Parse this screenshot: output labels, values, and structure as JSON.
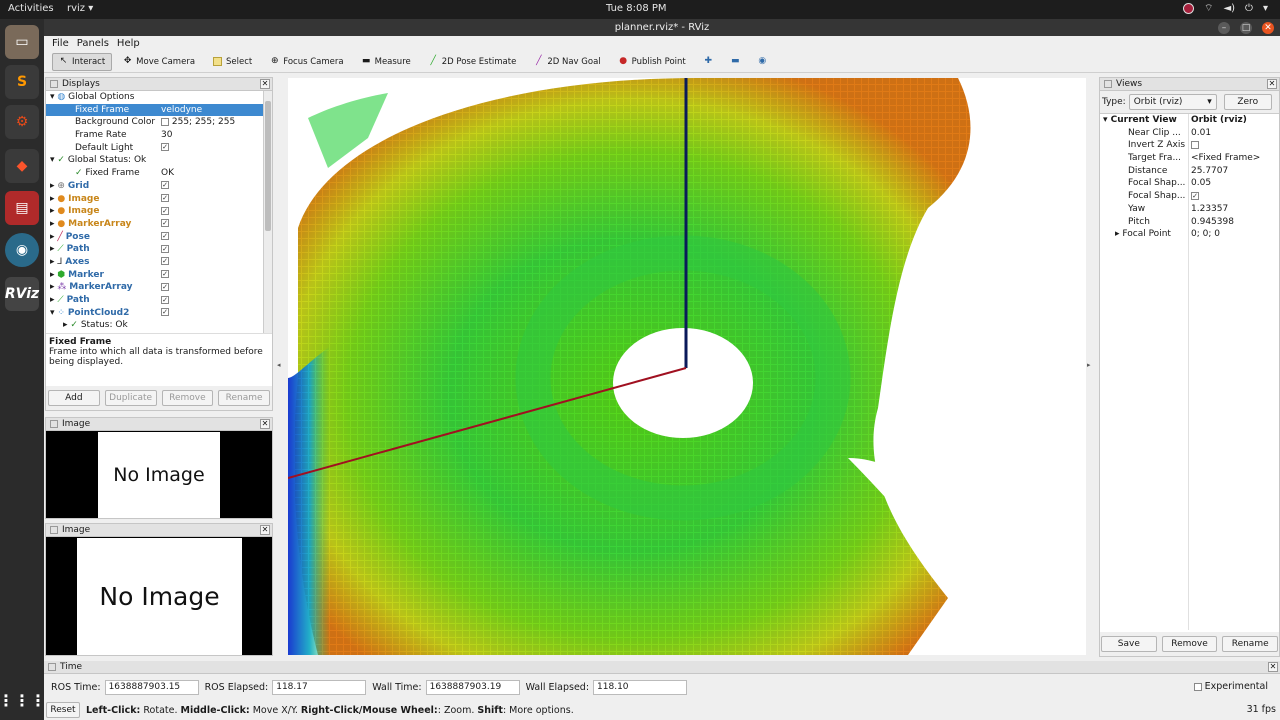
{
  "topbar": {
    "activities": "Activities",
    "app": "rviz",
    "clock": "Tue  8:08 PM"
  },
  "dock": {
    "rviz_label": "RViz"
  },
  "window": {
    "title": "planner.rviz* - RViz"
  },
  "menu": [
    "File",
    "Panels",
    "Help"
  ],
  "toolbar": [
    {
      "label": "Interact",
      "icon": "cursor-icon"
    },
    {
      "label": "Move Camera",
      "icon": "move-icon"
    },
    {
      "label": "Select",
      "icon": "select-icon"
    },
    {
      "label": "Focus Camera",
      "icon": "focus-icon"
    },
    {
      "label": "Measure",
      "icon": "ruler-icon"
    },
    {
      "label": "2D Pose Estimate",
      "icon": "arrow-green-icon"
    },
    {
      "label": "2D Nav Goal",
      "icon": "arrow-purple-icon"
    },
    {
      "label": "Publish Point",
      "icon": "pin-icon"
    }
  ],
  "displays": {
    "title": "Displays",
    "global_options": "Global Options",
    "fixed_frame_k": "Fixed Frame",
    "fixed_frame_v": "velodyne",
    "bg_k": "Background Color",
    "bg_v": "255; 255; 255",
    "fr_k": "Frame Rate",
    "fr_v": "30",
    "dl_k": "Default Light",
    "status_k": "Global Status: Ok",
    "status_ff_k": "Fixed Frame",
    "status_ff_v": "OK",
    "items": [
      "Grid",
      "Image",
      "Image",
      "MarkerArray",
      "Pose",
      "Path",
      "Axes",
      "Marker",
      "MarkerArray",
      "Path",
      "PointCloud2"
    ],
    "last_status": "Status: Ok",
    "desc_title": "Fixed Frame",
    "desc_body": "Frame into which all data is transformed before being displayed.",
    "buttons": {
      "add": "Add",
      "duplicate": "Duplicate",
      "remove": "Remove",
      "rename": "Rename"
    }
  },
  "image_panels": [
    {
      "title": "Image",
      "text": "No Image"
    },
    {
      "title": "Image",
      "text": "No Image"
    }
  ],
  "views": {
    "title": "Views",
    "type_label": "Type:",
    "type_value": "Orbit (rviz)",
    "zero": "Zero",
    "current_view": "Current View",
    "current_view_v": "Orbit (rviz)",
    "props": [
      {
        "k": "Near Clip ...",
        "v": "0.01"
      },
      {
        "k": "Invert Z Axis",
        "v": ""
      },
      {
        "k": "Target Fra...",
        "v": "<Fixed Frame>"
      },
      {
        "k": "Distance",
        "v": "25.7707"
      },
      {
        "k": "Focal Shap...",
        "v": "0.05"
      },
      {
        "k": "Focal Shap...",
        "v": ""
      },
      {
        "k": "Yaw",
        "v": "1.23357"
      },
      {
        "k": "Pitch",
        "v": "0.945398"
      },
      {
        "k": "Focal Point",
        "v": "0; 0; 0"
      }
    ],
    "save": "Save",
    "remove": "Remove",
    "rename": "Rename"
  },
  "time": {
    "title": "Time",
    "ros_time_label": "ROS Time:",
    "ros_time": "1638887903.15",
    "ros_elapsed_label": "ROS Elapsed:",
    "ros_elapsed": "118.17",
    "wall_time_label": "Wall Time:",
    "wall_time": "1638887903.19",
    "wall_elapsed_label": "Wall Elapsed:",
    "wall_elapsed": "118.10",
    "experimental": "Experimental"
  },
  "status": {
    "reset": "Reset",
    "b1": "Left-Click:",
    "t1": " Rotate. ",
    "b2": "Middle-Click:",
    "t2": " Move X/Y. ",
    "b3": "Right-Click/Mouse Wheel:",
    "t3": ": Zoom. ",
    "b4": "Shift",
    "t4": ": More options.",
    "fps": "31 fps"
  }
}
